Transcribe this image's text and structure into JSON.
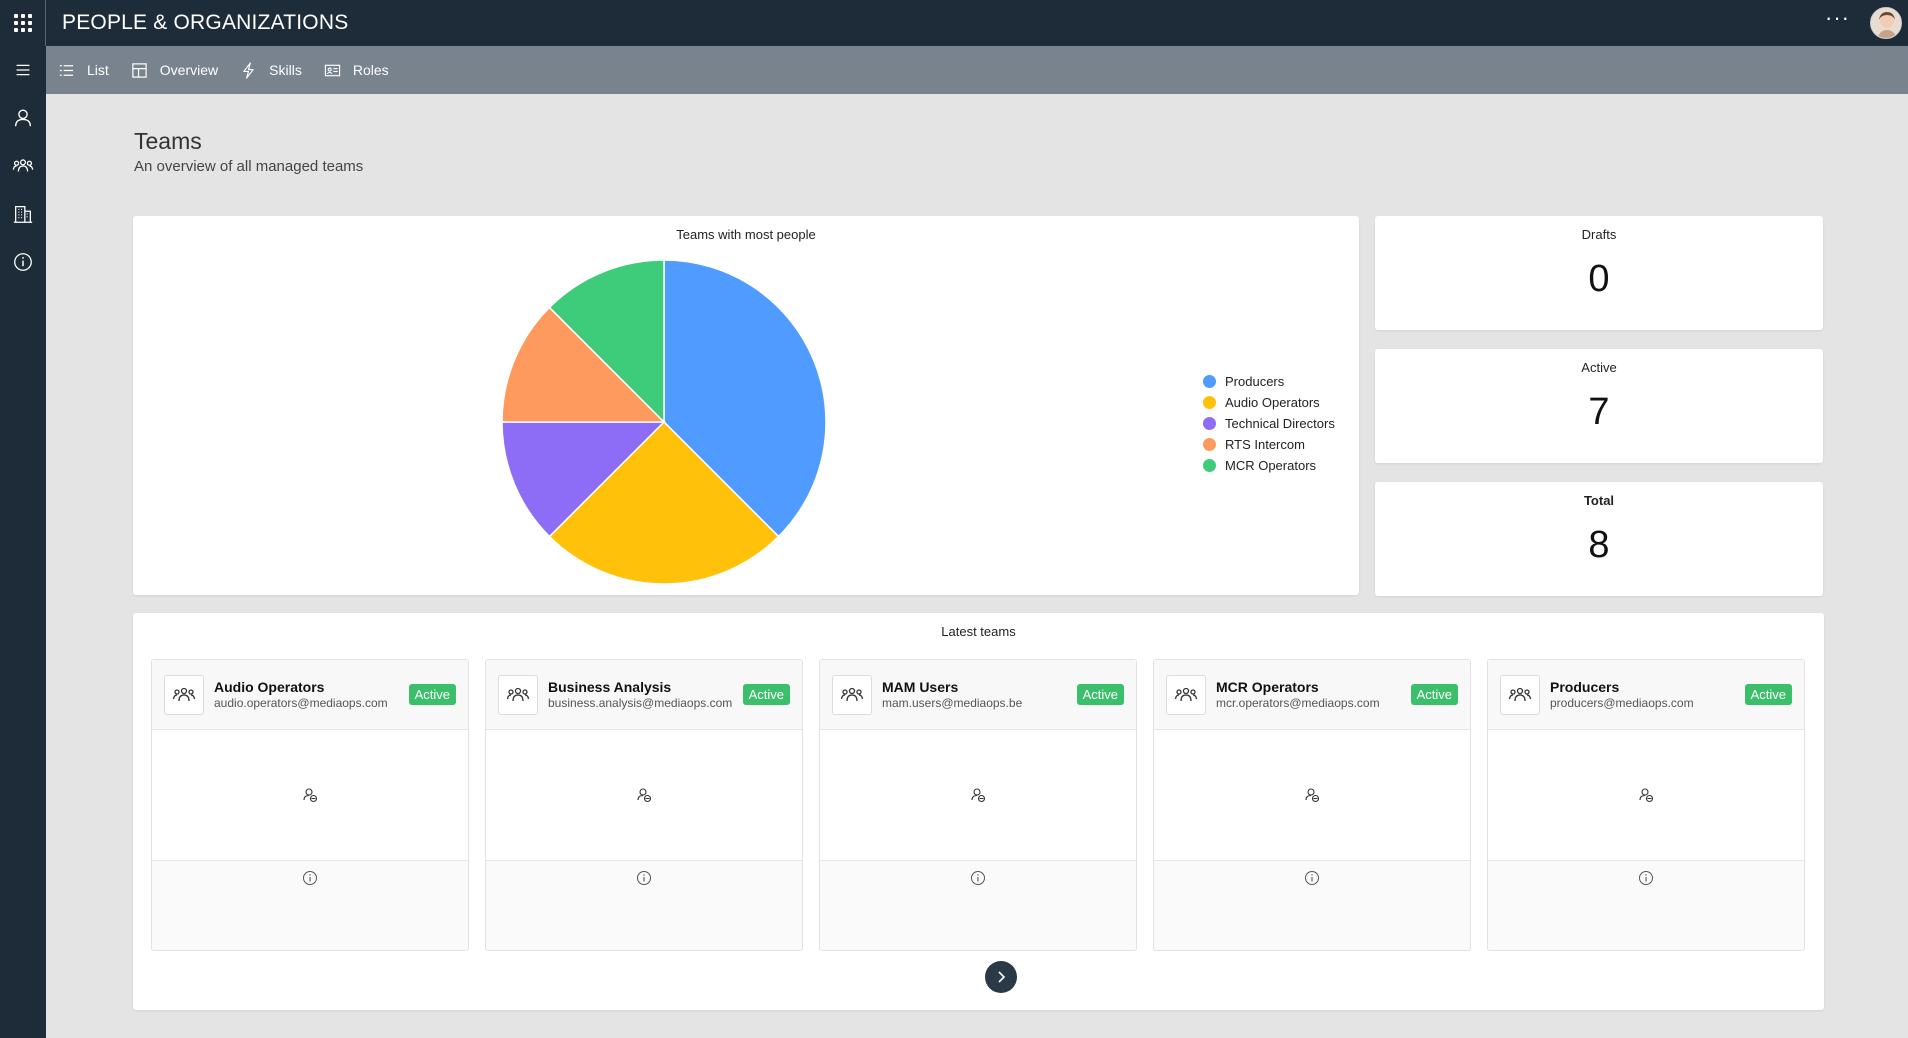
{
  "app": {
    "title": "PEOPLE & ORGANIZATIONS",
    "more_label": "···"
  },
  "subnav": [
    {
      "label": "List",
      "icon": "list-icon"
    },
    {
      "label": "Overview",
      "icon": "overview-icon"
    },
    {
      "label": "Skills",
      "icon": "lightning-icon"
    },
    {
      "label": "Roles",
      "icon": "id-card-icon"
    }
  ],
  "sidebar": [
    "menu-icon",
    "person-icon",
    "team-icon",
    "building-icon",
    "info-icon"
  ],
  "page": {
    "title": "Teams",
    "subtitle": "An overview of all managed teams"
  },
  "chart_data": {
    "type": "pie",
    "title": "Teams with most people",
    "categories": [
      "Producers",
      "Audio Operators",
      "Technical Directors",
      "RTS Intercom",
      "MCR Operators"
    ],
    "values": [
      3,
      2,
      1,
      1,
      1
    ],
    "colors": [
      "#4f9bff",
      "#ffc10a",
      "#8d6df5",
      "#ff9a5e",
      "#3ecc7a"
    ],
    "legend": "right"
  },
  "stats": {
    "drafts": {
      "label": "Drafts",
      "value": "0"
    },
    "active": {
      "label": "Active",
      "value": "7"
    },
    "total": {
      "label": "Total",
      "value": "8"
    }
  },
  "latest": {
    "title": "Latest teams",
    "teams": [
      {
        "name": "Audio Operators",
        "email": "audio.operators@mediaops.com",
        "status": "Active"
      },
      {
        "name": "Business Analysis",
        "email": "business.analysis@mediaops.com",
        "status": "Active"
      },
      {
        "name": "MAM Users",
        "email": "mam.users@mediaops.be",
        "status": "Active"
      },
      {
        "name": "MCR Operators",
        "email": "mcr.operators@mediaops.com",
        "status": "Active"
      },
      {
        "name": "Producers",
        "email": "producers@mediaops.com",
        "status": "Active"
      }
    ]
  }
}
